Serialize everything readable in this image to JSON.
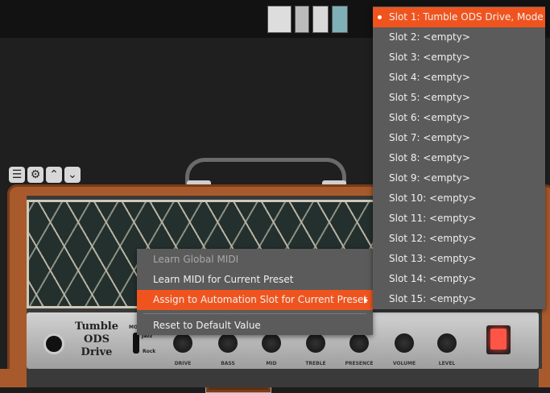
{
  "amp": {
    "name": "Tumble ODS Drive",
    "mode_label": "MODE",
    "mode_options": [
      "Jazz",
      "Rock"
    ],
    "knobs": [
      "DRIVE",
      "BASS",
      "MID",
      "TREBLE",
      "PRESENCE",
      "VOLUME",
      "LEVEL"
    ]
  },
  "context_menu": {
    "items": [
      {
        "label": "Learn Global MIDI",
        "state": "disabled"
      },
      {
        "label": "Learn MIDI for Current Preset",
        "state": "normal"
      },
      {
        "label": "Assign to Automation Slot for Current Preset",
        "state": "highlighted",
        "has_submenu": true
      },
      {
        "label": "Reset to Default Value",
        "state": "normal"
      }
    ]
  },
  "submenu": {
    "items": [
      {
        "label": "Slot 1: Tumble ODS Drive, Mode",
        "selected": true
      },
      {
        "label": "Slot 2: <empty>"
      },
      {
        "label": "Slot 3: <empty>"
      },
      {
        "label": "Slot 4: <empty>"
      },
      {
        "label": "Slot 5: <empty>"
      },
      {
        "label": "Slot 6: <empty>"
      },
      {
        "label": "Slot 7: <empty>"
      },
      {
        "label": "Slot 8: <empty>"
      },
      {
        "label": "Slot 9: <empty>"
      },
      {
        "label": "Slot 10: <empty>"
      },
      {
        "label": "Slot 11: <empty>"
      },
      {
        "label": "Slot 12: <empty>"
      },
      {
        "label": "Slot 13: <empty>"
      },
      {
        "label": "Slot 14: <empty>"
      },
      {
        "label": "Slot 15: <empty>"
      }
    ]
  },
  "toolbar_icons": [
    "menu-icon",
    "gear-icon",
    "chevron-up-icon",
    "chevron-down-icon"
  ],
  "colors": {
    "accent": "#f0541e",
    "menu_bg": "#5b5b5b",
    "amp_tolex": "#a85a2c"
  }
}
